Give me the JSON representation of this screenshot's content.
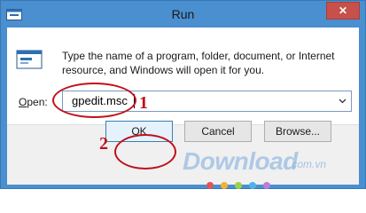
{
  "window": {
    "title": "Run",
    "close_glyph": "✕"
  },
  "dialog": {
    "description": "Type the name of a program, folder, document, or Internet resource, and Windows will open it for you.",
    "open_label": "Open:",
    "open_value": "gpedit.msc"
  },
  "buttons": {
    "ok": "OK",
    "cancel": "Cancel",
    "browse": "Browse..."
  },
  "annotations": {
    "step1": "1",
    "step2": "2",
    "color": "#c0101a"
  },
  "watermark": {
    "text": "Download",
    "suffix": ".com.vn",
    "dot_colors": [
      "#e05555",
      "#f2b233",
      "#9ad24a",
      "#4fb3e8",
      "#b77fd8"
    ]
  },
  "icons": {
    "app": "run-app-icon",
    "info": "run-info-icon",
    "close": "close-icon",
    "dropdown": "chevron-down-icon"
  },
  "colors": {
    "titlebar": "#4a8fcf",
    "close_button": "#c7504a"
  }
}
